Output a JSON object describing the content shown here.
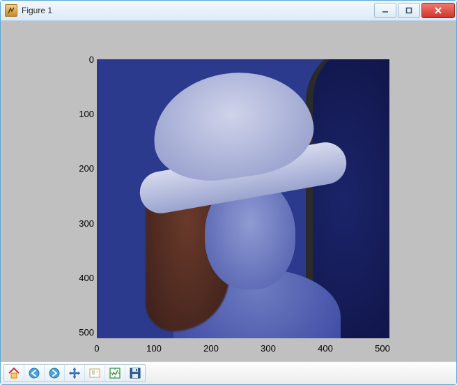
{
  "window": {
    "title": "Figure 1"
  },
  "axes": {
    "x_ticks": [
      "0",
      "100",
      "200",
      "300",
      "400",
      "500"
    ],
    "y_ticks": [
      "0",
      "100",
      "200",
      "300",
      "400",
      "500"
    ],
    "x_range": [
      0,
      512
    ],
    "y_range": [
      512,
      0
    ]
  },
  "toolbar": {
    "buttons": [
      {
        "name": "home-button",
        "icon": "home-icon"
      },
      {
        "name": "back-button",
        "icon": "arrow-left-icon"
      },
      {
        "name": "forward-button",
        "icon": "arrow-right-icon"
      },
      {
        "name": "pan-button",
        "icon": "move-icon"
      },
      {
        "name": "zoom-button",
        "icon": "zoom-rect-icon"
      },
      {
        "name": "subplots-button",
        "icon": "configure-subplots-icon"
      },
      {
        "name": "save-button",
        "icon": "save-icon"
      }
    ]
  },
  "window_controls": {
    "minimize": "minimize",
    "maximize": "maximize",
    "close": "close"
  }
}
